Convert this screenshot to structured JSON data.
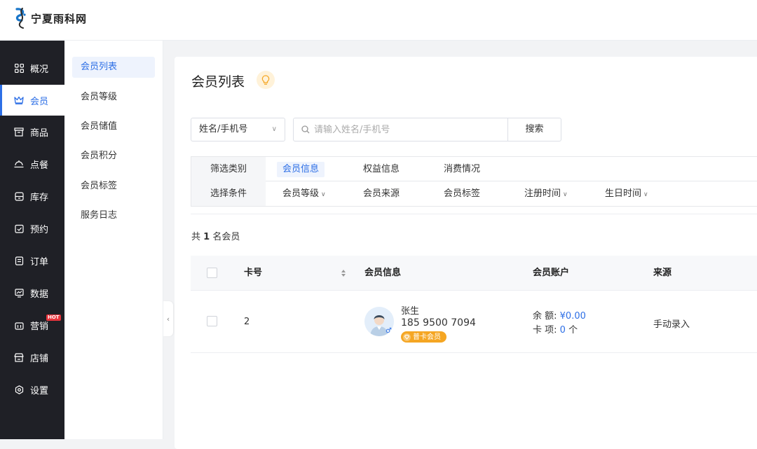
{
  "brand": {
    "name": "宁夏雨科网"
  },
  "sidebar": {
    "items": [
      {
        "label": "概况",
        "icon": "grid-icon"
      },
      {
        "label": "会员",
        "icon": "crown-icon"
      },
      {
        "label": "商品",
        "icon": "product-icon"
      },
      {
        "label": "点餐",
        "icon": "dish-icon"
      },
      {
        "label": "库存",
        "icon": "inventory-icon"
      },
      {
        "label": "预约",
        "icon": "calendar-check-icon"
      },
      {
        "label": "订单",
        "icon": "order-icon"
      },
      {
        "label": "数据",
        "icon": "chart-icon"
      },
      {
        "label": "营销",
        "icon": "marketing-icon",
        "badge": "HOT"
      },
      {
        "label": "店铺",
        "icon": "store-icon"
      },
      {
        "label": "设置",
        "icon": "settings-icon"
      }
    ]
  },
  "subnav": {
    "items": [
      {
        "label": "会员列表"
      },
      {
        "label": "会员等级"
      },
      {
        "label": "会员储值"
      },
      {
        "label": "会员积分"
      },
      {
        "label": "会员标签"
      },
      {
        "label": "服务日志"
      }
    ]
  },
  "page": {
    "title": "会员列表"
  },
  "search": {
    "select_value": "姓名/手机号",
    "placeholder": "请输入姓名/手机号",
    "button_label": "搜索"
  },
  "filter": {
    "row1_label": "筛选类别",
    "row1_chips": [
      "会员信息",
      "权益信息",
      "消费情况"
    ],
    "row2_label": "选择条件",
    "row2_chips": [
      "会员等级",
      "会员来源",
      "会员标签",
      "注册时间",
      "生日时间"
    ]
  },
  "summary": {
    "prefix": "共",
    "count": "1",
    "suffix": "名会员"
  },
  "table": {
    "headers": [
      "卡号",
      "会员信息",
      "会员账户",
      "来源"
    ],
    "rows": [
      {
        "card_no": "2",
        "name": "张生",
        "phone": "185 9500 7094",
        "level_tag": "普卡会员",
        "balance_label": "余 额:",
        "balance_value": "¥0.00",
        "card_items_label": "卡 项:",
        "card_items_value": "0",
        "card_items_unit": "个",
        "source": "手动录入"
      }
    ]
  },
  "colors": {
    "accent": "#2d6fe6",
    "sidebar_bg": "#1f2026",
    "tag": "#f5a623",
    "hot": "#e8343c"
  }
}
